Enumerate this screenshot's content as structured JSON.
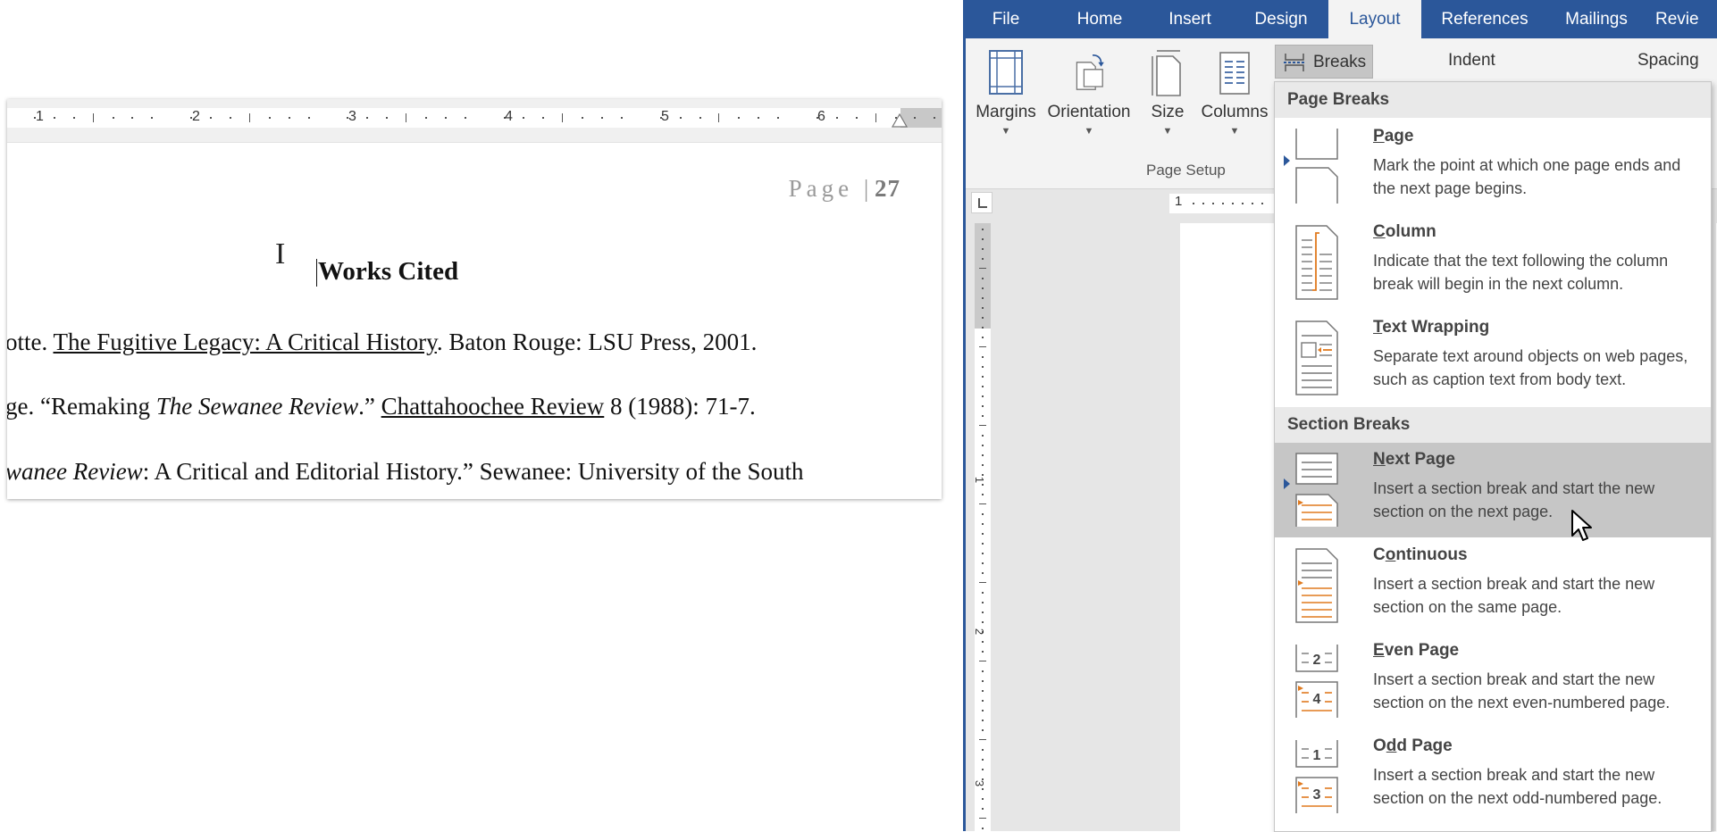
{
  "document": {
    "ruler_numbers": [
      "1",
      "2",
      "3",
      "4",
      "5",
      "6"
    ],
    "page_header_word": "Page",
    "page_header_number": "27",
    "heading": "Works Cited",
    "citations": [
      {
        "before": "otte.  ",
        "underlined": "The Fugitive Legacy: A Critical History",
        "italic": "",
        "after": ".  Baton Rouge: LSU Press, 2001."
      },
      {
        "before": "ge.  “Remaking ",
        "italic": "The Sewanee Review",
        "mid": ".” ",
        "underlined": "Chattahoochee Review",
        "after": " 8 (1988): 71-7."
      },
      {
        "italic_start": "wanee Review",
        "after": ": A Critical and Editorial History.” Sewanee: University of the South"
      }
    ]
  },
  "word": {
    "tabs": [
      "File",
      "Home",
      "Insert",
      "Design",
      "Layout",
      "References",
      "Mailings",
      "Revie"
    ],
    "active_tab": "Layout",
    "ribbon": {
      "buttons": [
        "Margins",
        "Orientation",
        "Size",
        "Columns"
      ],
      "breaks_label": "Breaks",
      "indent_label": "Indent",
      "spacing_label": "Spacing",
      "group_label": "Page Setup"
    },
    "hruler_number": "1",
    "vruler_numbers": [
      "1",
      "2",
      "3"
    ],
    "accent": "#2b579a",
    "orange": "#e07a1f"
  },
  "breaks_menu": {
    "page_breaks_header": "Page Breaks",
    "section_breaks_header": "Section Breaks",
    "items": [
      {
        "title": "Page",
        "key": "P",
        "rest": "age",
        "desc": "Mark the point at which one page ends and the next page begins."
      },
      {
        "title": "Column",
        "key": "C",
        "rest": "olumn",
        "desc": "Indicate that the text following the column break will begin in the next column."
      },
      {
        "title": "Text Wrapping",
        "key": "T",
        "rest": "ext Wrapping",
        "desc": "Separate text around objects on web pages, such as caption text from body text."
      },
      {
        "title": "Next Page",
        "key": "N",
        "rest": "ext Page",
        "desc": "Insert a section break and start the new section on the next page."
      },
      {
        "title": "Continuous",
        "key": "o",
        "pre": "C",
        "rest": "ntinuous",
        "desc": "Insert a section break and start the new section on the same page."
      },
      {
        "title": "Even Page",
        "key": "E",
        "rest": "ven Page",
        "desc": "Insert a section break and start the new section on the next even-numbered page."
      },
      {
        "title": "Odd Page",
        "key": "d",
        "pre": "O",
        "rest": "d Page",
        "desc": "Insert a section break and start the new section on the next odd-numbered page."
      }
    ],
    "icon_numbers": {
      "even_top": "2",
      "even_bottom": "4",
      "odd_top": "1",
      "odd_bottom": "3"
    }
  }
}
